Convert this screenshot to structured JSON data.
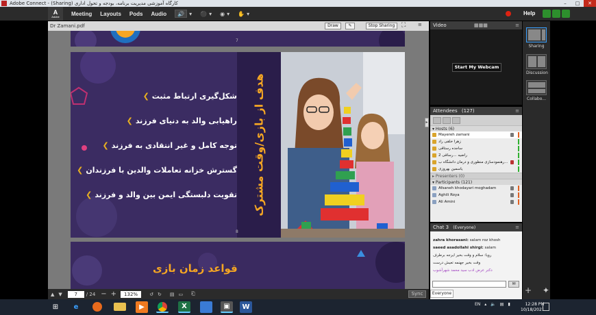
{
  "window": {
    "title": "Adobe Connect - (Sharing) کارگاه آموزشی مدیریت برنامه، بودجه و تحول اداری"
  },
  "menubar": {
    "logo_letter": "A",
    "logo_sub": "Adobe",
    "items": [
      "Meeting",
      "Layouts",
      "Pods",
      "Audio"
    ],
    "help": "Help"
  },
  "share_pod": {
    "title": "Dr Zamani.pdf",
    "draw_label": "Draw",
    "stop_sharing_label": "Stop Sharing",
    "page_current": "7",
    "page_total": "/ 24",
    "zoom": "132%",
    "sync_label": "Sync"
  },
  "slides": {
    "s7_num": "7",
    "s8_num": "8",
    "s8_title": "هدف از بازی/وقت مشترک",
    "bullets": [
      "شکل‌گیری ارتباط مثبت",
      "راهیابی والد به دنیای فرزند",
      "توجه کامل و غیر انتقادی به فرزند",
      "گسترش خزانه تعاملات والدین با فرزندان",
      "تقویت دلبستگی ایمن بین والد و فرزند"
    ],
    "s9_title": "قواعد زمان بازی"
  },
  "video_pod": {
    "title": "Video",
    "webcam_button": "Start My Webcam"
  },
  "attendees_pod": {
    "title": "Attendees",
    "count": "(127)",
    "hosts_label": "Hosts (6)",
    "hosts": [
      "Mayereh zamani",
      "زهرا خلقی راد",
      "ساجده رستاقی",
      "راضیه ...رساقی 2",
      "رهنمودسازی منطوری و درمان دانشگاه ب...",
      "یاسمین بهروزی"
    ],
    "presenters_label": "Presenters (0)",
    "participants_label": "Participants (121)",
    "participants": [
      "Afsaneh khodayari moghadam",
      "Aghili Roya",
      "Ali Amini"
    ]
  },
  "chat_pod": {
    "title": "Chat 3",
    "scope": "(Everyone)",
    "messages": [
      {
        "name": "zahra khorasani:",
        "text": "salam roz khosh"
      },
      {
        "name": "saeed asadollahi shirgi:",
        "text": "salam"
      },
      {
        "name": "",
        "text": "رویا: سلام و وقت بخیر ایرجه برطرف"
      },
      {
        "name": "",
        "text": "وقت بخیر جهنمه تعیش درست"
      },
      {
        "name": "",
        "text": "دکتر عرض ادب سید محمد شهرآشوب"
      }
    ],
    "tab_label": "Everyone"
  },
  "layouts": [
    {
      "label": "Sharing"
    },
    {
      "label": "Discussion"
    },
    {
      "label": "Collabo..."
    }
  ],
  "taskbar": {
    "lang": "EN",
    "time": "12:28 PM",
    "date": "10/18/2021"
  }
}
